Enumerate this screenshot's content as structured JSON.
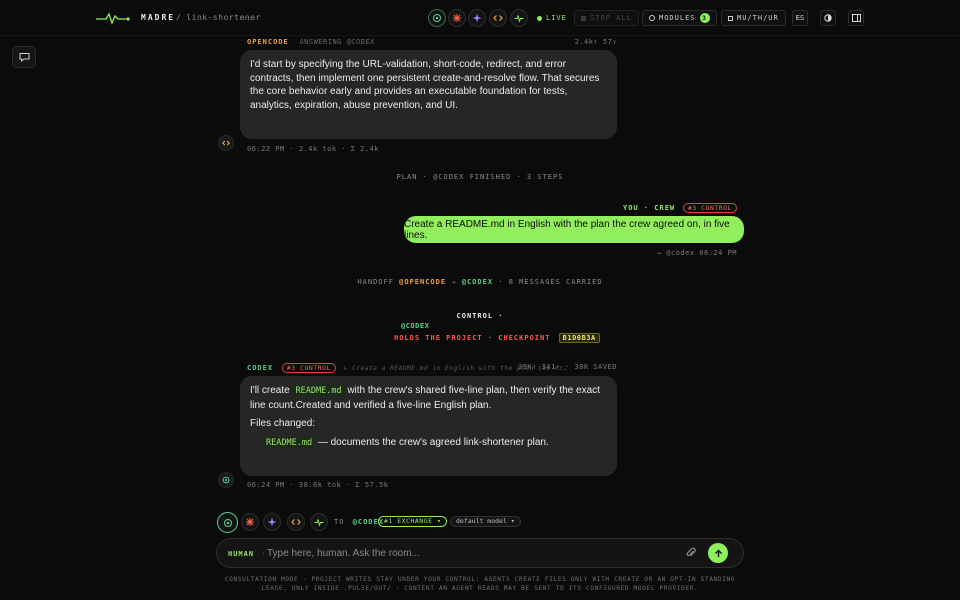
{
  "header": {
    "brand": "MADRE",
    "sep": "/",
    "project": "link-shortener",
    "live": "LIVE",
    "stop_all": "STOP ALL",
    "modules": "MODULES",
    "modules_count": "3",
    "lang_pack": "MU/TH/UR",
    "lang": "ES"
  },
  "agents_icons": [
    "target-icon",
    "burst-icon",
    "sparkle-icon",
    "code-icon",
    "pulse-icon"
  ],
  "messages": {
    "m1": {
      "author": "OPENCODE",
      "answering": "ANSWERING @CODEX",
      "tokens_right": "2.4k↑ 57↑",
      "text": "I'd start by specifying the URL-validation, short-code, redirect, and error contracts, then implement one persistent create-and-resolve flow. That secures the core behavior early and provides an executable foundation for tests, analytics, expiration, abuse prevention, and UI.",
      "meta": "06:22 PM · 2.4k tok · Σ 2.4k"
    },
    "plan": "PLAN · @CODEX FINISHED · 3 STEPS",
    "you": {
      "label": "YOU · CREW",
      "tag": "#3 CONTROL",
      "text": "Create a README.md in English with the plan the crew agreed on, in five lines.",
      "meta": "→ @codex   06:24 PM"
    },
    "handoff": {
      "prefix": "HANDOFF",
      "from": "@OPENCODE",
      "arrow": "→",
      "to": "@CODEX",
      "suffix": "· 8 MESSAGES CARRIED"
    },
    "control": {
      "title": "CONTROL ·",
      "who": "@CODEX",
      "holds": "HOLDS THE PROJECT · CHECKPOINT",
      "checkpoint": "B1D0B3A"
    },
    "m2": {
      "author": "CODEX",
      "tag": "#3 CONTROL",
      "quote": "↳ Create a README.md in English with the plan the cr…",
      "tokens_right": "39K↑ 341↑ · 38K SAVED",
      "line1_pre": "I'll create",
      "file": "README.md",
      "line1_post": "with the crew's shared five-line plan, then verify the exact line count.Created and verified a five-line English plan.",
      "files_changed": "Files changed:",
      "bullet_file": "README.md",
      "bullet_text": "— documents the crew's agreed link-shortener plan.",
      "meta": "06:24 PM · 38.6k tok · Σ 57.5k"
    }
  },
  "composer": {
    "to_label": "TO",
    "to_target": "@CODEX",
    "exchange": "#1 EXCHANGE ▾",
    "model": "default model ▾",
    "human": "HUMAN",
    "dot": "·",
    "placeholder": "Type here, human. Ask the room...",
    "footer": "CONSULTATION MODE · PROJECT WRITES STAY UNDER YOUR CONTROL: AGENTS CREATE FILES ONLY WITH CREATE OR AN OPT-IN STANDING LEASE, ONLY INSIDE .PULSE/OUT/ · CONTENT AN AGENT READS MAY BE SENT TO ITS CONFIGURED MODEL PROVIDER."
  },
  "colors": {
    "accent": "#8ef05a",
    "red": "#e0443a",
    "bg": "#0b0b0b",
    "bubble": "#262626",
    "orange": "#f0a040"
  }
}
